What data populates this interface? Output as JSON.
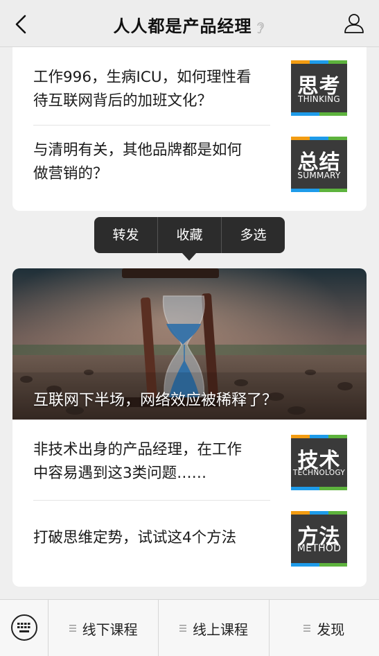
{
  "header": {
    "title": "人人都是产品经理",
    "back_icon": "chevron-left-icon",
    "ear_icon": "ear-icon",
    "profile_icon": "person-icon"
  },
  "top_card": {
    "items": [
      {
        "line1": "工作996，生病ICU，如何理性看",
        "line2": "待互联网背后的加班文化？",
        "badge_zh": "思考",
        "badge_en": "THINKING"
      },
      {
        "line1": "与清明有关，其他品牌都是如何",
        "line2": "做营销的？",
        "badge_zh": "总结",
        "badge_en": "SUMMARY"
      }
    ]
  },
  "context_menu": {
    "items": [
      "转发",
      "收藏",
      "多选"
    ]
  },
  "bottom_card": {
    "hero_title": "互联网下半场，网络效应被稀释了？",
    "items": [
      {
        "line1": "非技术出身的产品经理，在工作",
        "line2": "中容易遇到这3类问题……",
        "badge_zh": "技术",
        "badge_en": "TECHNOLOGY"
      },
      {
        "line1": "打破思维定势，试试这4个方法",
        "line2": "",
        "badge_zh": "方法",
        "badge_en": "METHOD"
      }
    ]
  },
  "bottom_nav": {
    "keyboard_icon": "keyboard-icon",
    "tabs": [
      "线下课程",
      "线上课程",
      "发现"
    ]
  },
  "colors": {
    "badge_bg": "#3a3a3a",
    "stripe_orange": "#f39c12",
    "stripe_blue": "#1e9be9",
    "stripe_green": "#5db33d",
    "menu_bg": "#2c2c2c"
  }
}
